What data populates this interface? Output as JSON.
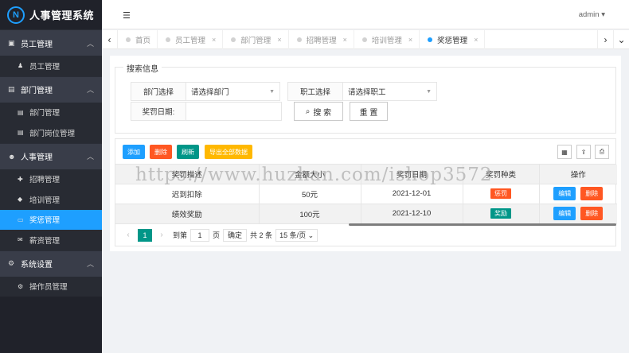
{
  "app": {
    "title": "人事管理系统",
    "logo_text": "N"
  },
  "header": {
    "user": "admin ▾"
  },
  "sidebar": {
    "groups": [
      {
        "label": "员工管理",
        "items": [
          {
            "label": "员工管理"
          }
        ]
      },
      {
        "label": "部门管理",
        "items": [
          {
            "label": "部门管理"
          },
          {
            "label": "部门岗位管理"
          }
        ]
      },
      {
        "label": "人事管理",
        "items": [
          {
            "label": "招聘管理"
          },
          {
            "label": "培训管理"
          },
          {
            "label": "奖惩管理"
          },
          {
            "label": "薪资管理"
          }
        ]
      },
      {
        "label": "系统设置",
        "items": [
          {
            "label": "操作员管理"
          }
        ]
      }
    ]
  },
  "tabs": [
    {
      "label": "首页"
    },
    {
      "label": "员工管理"
    },
    {
      "label": "部门管理"
    },
    {
      "label": "招聘管理"
    },
    {
      "label": "培训管理"
    },
    {
      "label": "奖惩管理"
    }
  ],
  "search": {
    "legend": "搜索信息",
    "dept_label": "部门选择",
    "dept_value": "请选择部门",
    "emp_label": "职工选择",
    "emp_value": "请选择职工",
    "date_label": "奖罚日期:",
    "search_btn": "搜 索",
    "reset_btn": "重 置"
  },
  "toolbar": {
    "add": "添加",
    "delete": "删除",
    "refresh": "刷新",
    "export": "导出全部数据"
  },
  "table": {
    "headers": [
      "奖罚描述",
      "金额大小",
      "奖罚日期",
      "奖罚种类",
      "操作"
    ],
    "rows": [
      {
        "desc": "迟到扣除",
        "amount": "50元",
        "date": "2021-12-01",
        "kind": "惩罚",
        "edit": "编辑",
        "del": "删除"
      },
      {
        "desc": "绩效奖励",
        "amount": "100元",
        "date": "2021-12-10",
        "kind": "奖励",
        "edit": "编辑",
        "del": "删除"
      }
    ]
  },
  "pager": {
    "current": "1",
    "goto": "到第",
    "page_input": "1",
    "page_unit": "页",
    "confirm": "确定",
    "total": "共 2 条",
    "page_size": "15 条/页 ⌄"
  },
  "watermark": "https://www.huzhan.com/ishop3572",
  "colors": {
    "accent": "#1e9fff",
    "warn": "#ff5722",
    "green": "#009688",
    "orange": "#ffb800"
  }
}
